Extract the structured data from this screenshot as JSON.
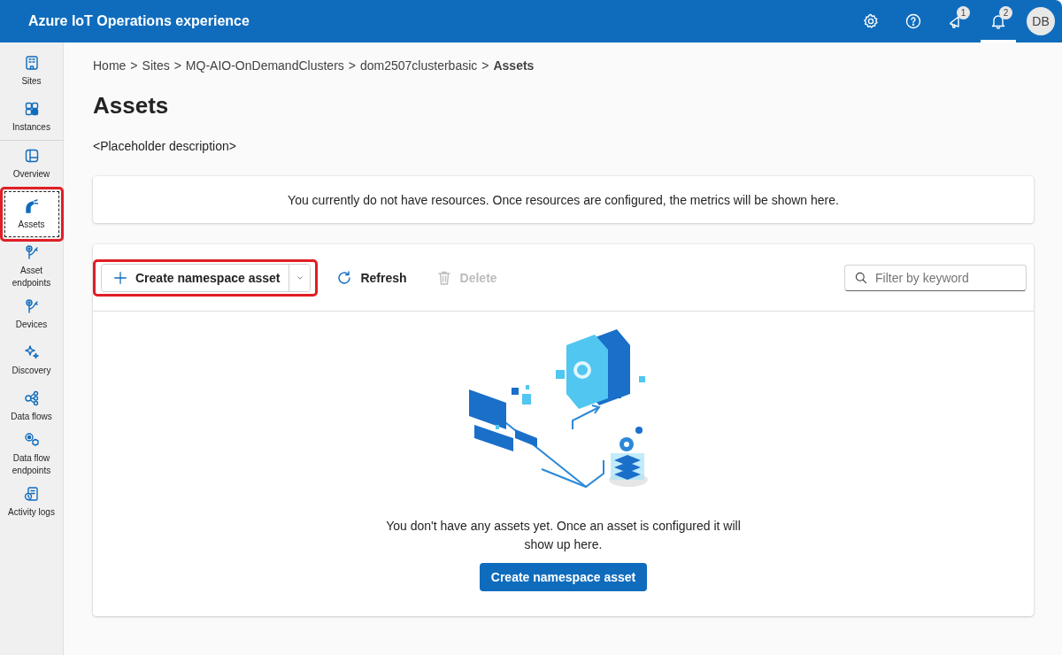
{
  "header": {
    "title": "Azure IoT Operations experience",
    "feedback_badge": "1",
    "notifications_badge": "2",
    "notifications_selected": true,
    "avatar": "DB"
  },
  "sidebar": {
    "items": [
      {
        "label": "Sites",
        "selected": false,
        "highlighted": false
      },
      {
        "label": "Instances",
        "selected": false,
        "highlighted": false
      },
      {
        "label": "Overview",
        "selected": false,
        "highlighted": false
      },
      {
        "label": "Assets",
        "selected": true,
        "highlighted": true
      },
      {
        "label": "Asset endpoints",
        "selected": false,
        "highlighted": false
      },
      {
        "label": "Devices",
        "selected": false,
        "highlighted": false
      },
      {
        "label": "Discovery",
        "selected": false,
        "highlighted": false
      },
      {
        "label": "Data flows",
        "selected": false,
        "highlighted": false
      },
      {
        "label": "Data flow endpoints",
        "selected": false,
        "highlighted": false
      },
      {
        "label": "Activity logs",
        "selected": false,
        "highlighted": false
      }
    ]
  },
  "breadcrumb_separator": ">",
  "breadcrumb": [
    "Home",
    "Sites",
    "MQ-AIO-OnDemandClusters",
    "dom2507clusterbasic",
    "Assets"
  ],
  "page": {
    "title": "Assets",
    "description": "<Placeholder description>"
  },
  "metrics_notice": "You currently do not have resources. Once resources are configured, the metrics will be shown here.",
  "toolbar": {
    "create": {
      "label": "Create namespace asset",
      "highlighted": true
    },
    "refresh": {
      "label": "Refresh",
      "disabled": false
    },
    "delete": {
      "label": "Delete",
      "disabled": true
    },
    "filter": {
      "placeholder": "Filter by keyword"
    }
  },
  "empty_state": {
    "message": "You don't have any assets yet. Once an asset is configured it will show up here.",
    "button": "Create namespace asset"
  }
}
